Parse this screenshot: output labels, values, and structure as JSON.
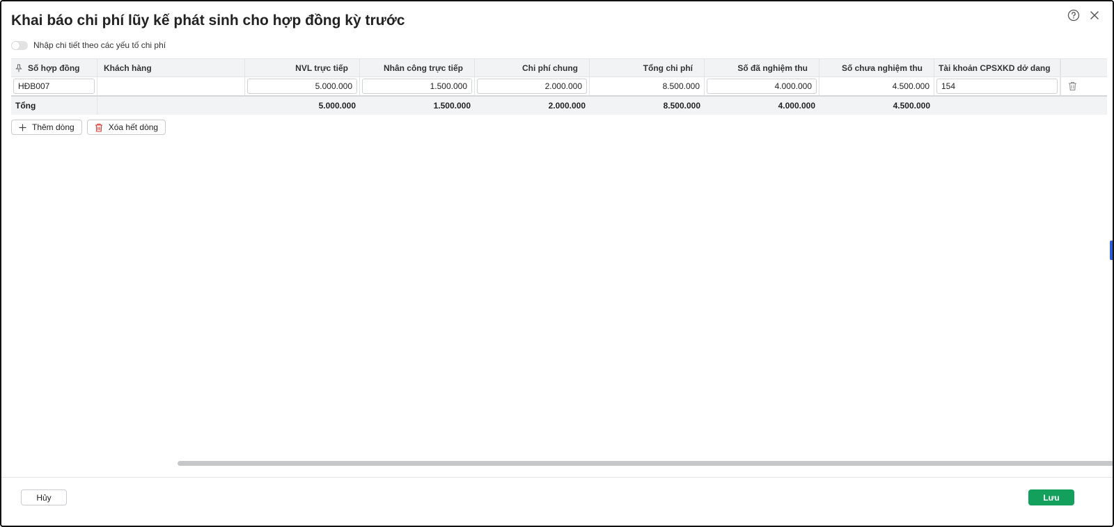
{
  "dialog": {
    "title": "Khai báo chi phí lũy kế phát sinh cho hợp đồng kỳ trước",
    "help_icon": "help-circle-icon",
    "close_icon": "close-icon"
  },
  "toggle": {
    "label": "Nhập chi tiết theo các yếu tố chi phí",
    "on": false
  },
  "table": {
    "columns": [
      "Số hợp đồng",
      "Khách hàng",
      "NVL trực tiếp",
      "Nhân công trực tiếp",
      "Chi phí chung",
      "Tổng chi phí",
      "Số đã nghiệm thu",
      "Số chưa nghiệm thu",
      "Tài khoản CPSXKD dở dang"
    ],
    "rows": [
      {
        "contract_no": "HĐB007",
        "customer": "",
        "direct_material": "5.000.000",
        "direct_labor": "1.500.000",
        "overhead": "2.000.000",
        "total_cost": "8.500.000",
        "accepted": "4.000.000",
        "not_accepted": "4.500.000",
        "wip_account": "154"
      }
    ],
    "totals": {
      "label": "Tổng",
      "direct_material": "5.000.000",
      "direct_labor": "1.500.000",
      "overhead": "2.000.000",
      "total_cost": "8.500.000",
      "accepted": "4.000.000",
      "not_accepted": "4.500.000"
    }
  },
  "actions": {
    "add_row": "Thêm dòng",
    "clear_rows": "Xóa hết dòng"
  },
  "footer": {
    "cancel": "Hủy",
    "save": "Lưu"
  },
  "colors": {
    "accent": "#12a05c",
    "danger": "#e0302a",
    "side_tab": "#2f5bd5"
  }
}
